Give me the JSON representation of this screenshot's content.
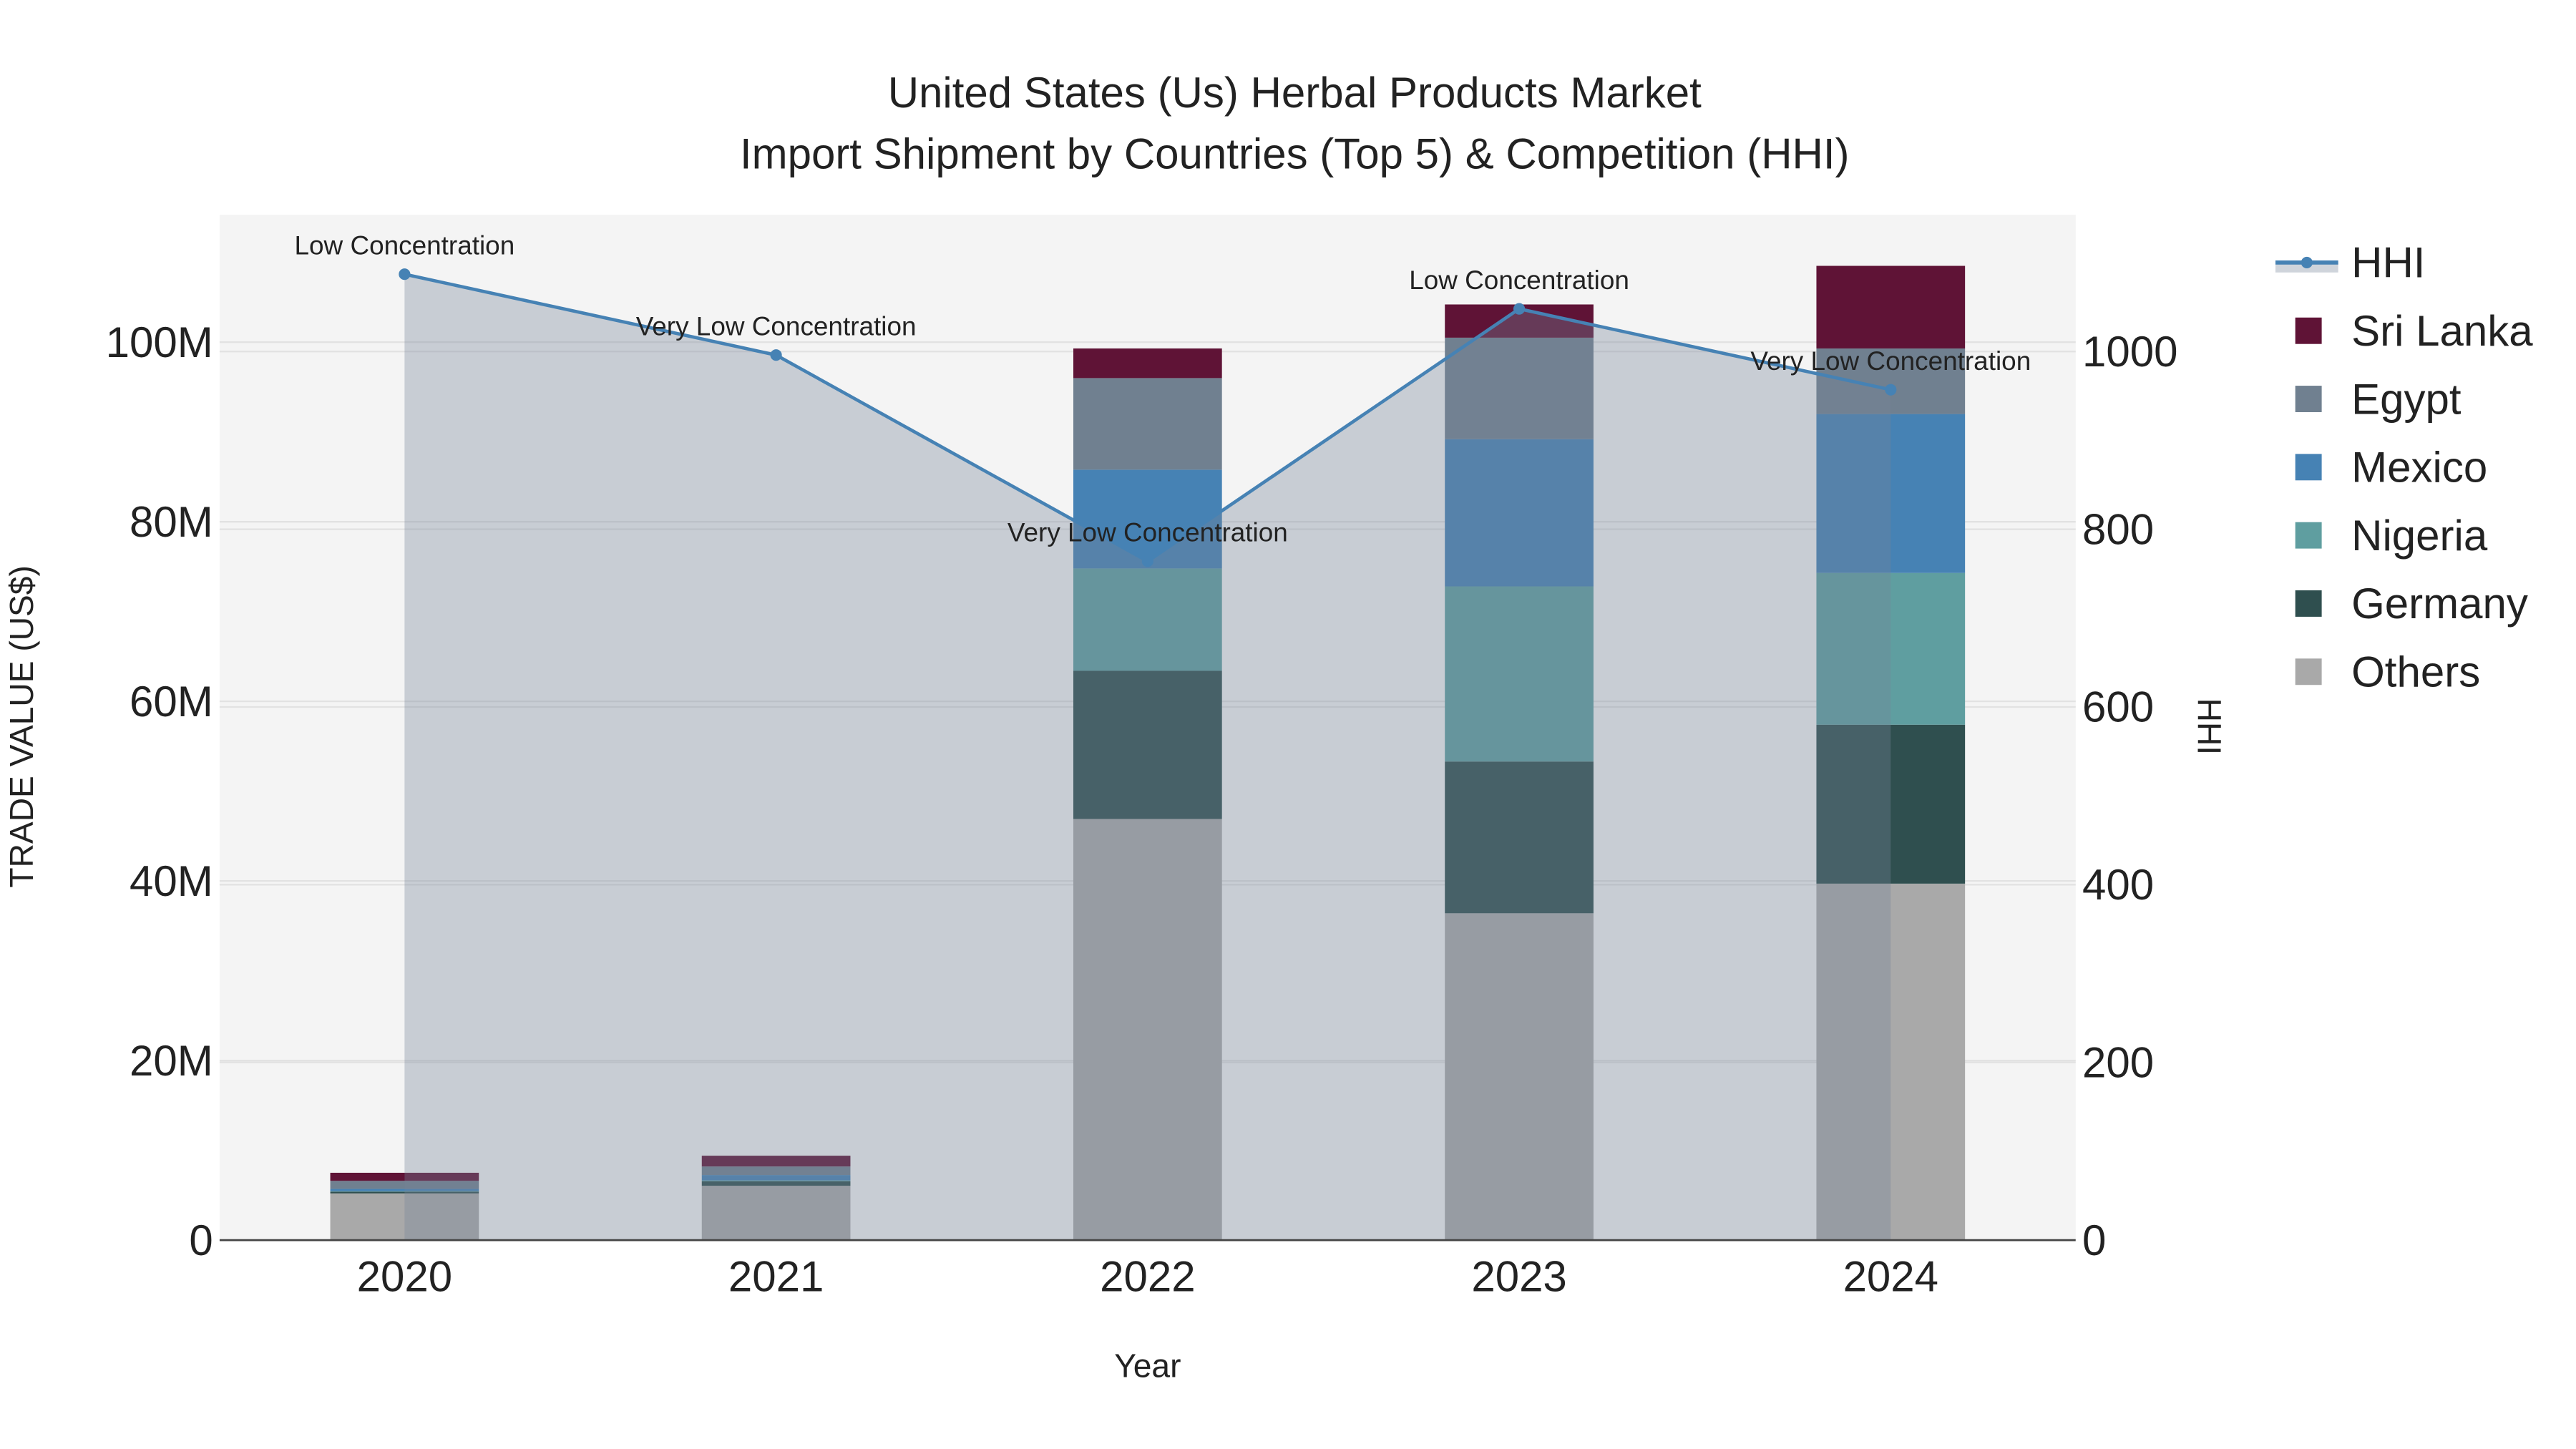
{
  "chart_data": {
    "type": "bar",
    "title_lines": [
      "United States (Us) Herbal Products Market",
      "Import Shipment by Countries (Top 5) & Competition (HHI)"
    ],
    "xlabel": "Year",
    "ylabel": "TRADE VALUE (US$)",
    "y2label": "HHI",
    "categories": [
      "2020",
      "2021",
      "2022",
      "2023",
      "2024"
    ],
    "ylim": [
      0,
      114.2
    ],
    "y_unit": "M",
    "y_ticks": [
      0,
      20,
      40,
      60,
      80,
      100
    ],
    "y_tick_labels": [
      "0",
      "20M",
      "40M",
      "60M",
      "80M",
      "100M"
    ],
    "y2lim": [
      0,
      1154
    ],
    "y2_ticks": [
      0,
      200,
      400,
      600,
      800,
      1000
    ],
    "y2_tick_labels": [
      "0",
      "200",
      "400",
      "600",
      "800",
      "1000"
    ],
    "grid": true,
    "legend_position": "right",
    "series": [
      {
        "name": "Others",
        "color": "#a9a9a9",
        "values": [
          5.2,
          6.05,
          46.9,
          36.4,
          39.7
        ]
      },
      {
        "name": "Germany",
        "color": "#2f4f4f",
        "values": [
          0.2,
          0.5,
          16.5,
          16.9,
          17.7
        ]
      },
      {
        "name": "Nigeria",
        "color": "#5f9ea0",
        "values": [
          0.05,
          0.1,
          11.4,
          19.5,
          16.9
        ]
      },
      {
        "name": "Mexico",
        "color": "#4682b4",
        "values": [
          0.25,
          0.6,
          11.0,
          16.4,
          17.7
        ]
      },
      {
        "name": "Egypt",
        "color": "#708090",
        "values": [
          0.9,
          0.95,
          10.2,
          11.3,
          7.3
        ]
      },
      {
        "name": "Sri Lanka",
        "color": "#5f1336",
        "values": [
          0.9,
          1.2,
          3.3,
          3.7,
          9.2
        ]
      }
    ],
    "hhi": {
      "name": "HHI",
      "color": "#4682b4",
      "values": [
        1087,
        996,
        764,
        1048,
        957
      ],
      "annotations": [
        "Low Concentration",
        "Very Low Concentration",
        "Very Low Concentration",
        "Low Concentration",
        "Very Low Concentration"
      ]
    },
    "legend_order": [
      "HHI",
      "Sri Lanka",
      "Egypt",
      "Mexico",
      "Nigeria",
      "Germany",
      "Others"
    ]
  }
}
